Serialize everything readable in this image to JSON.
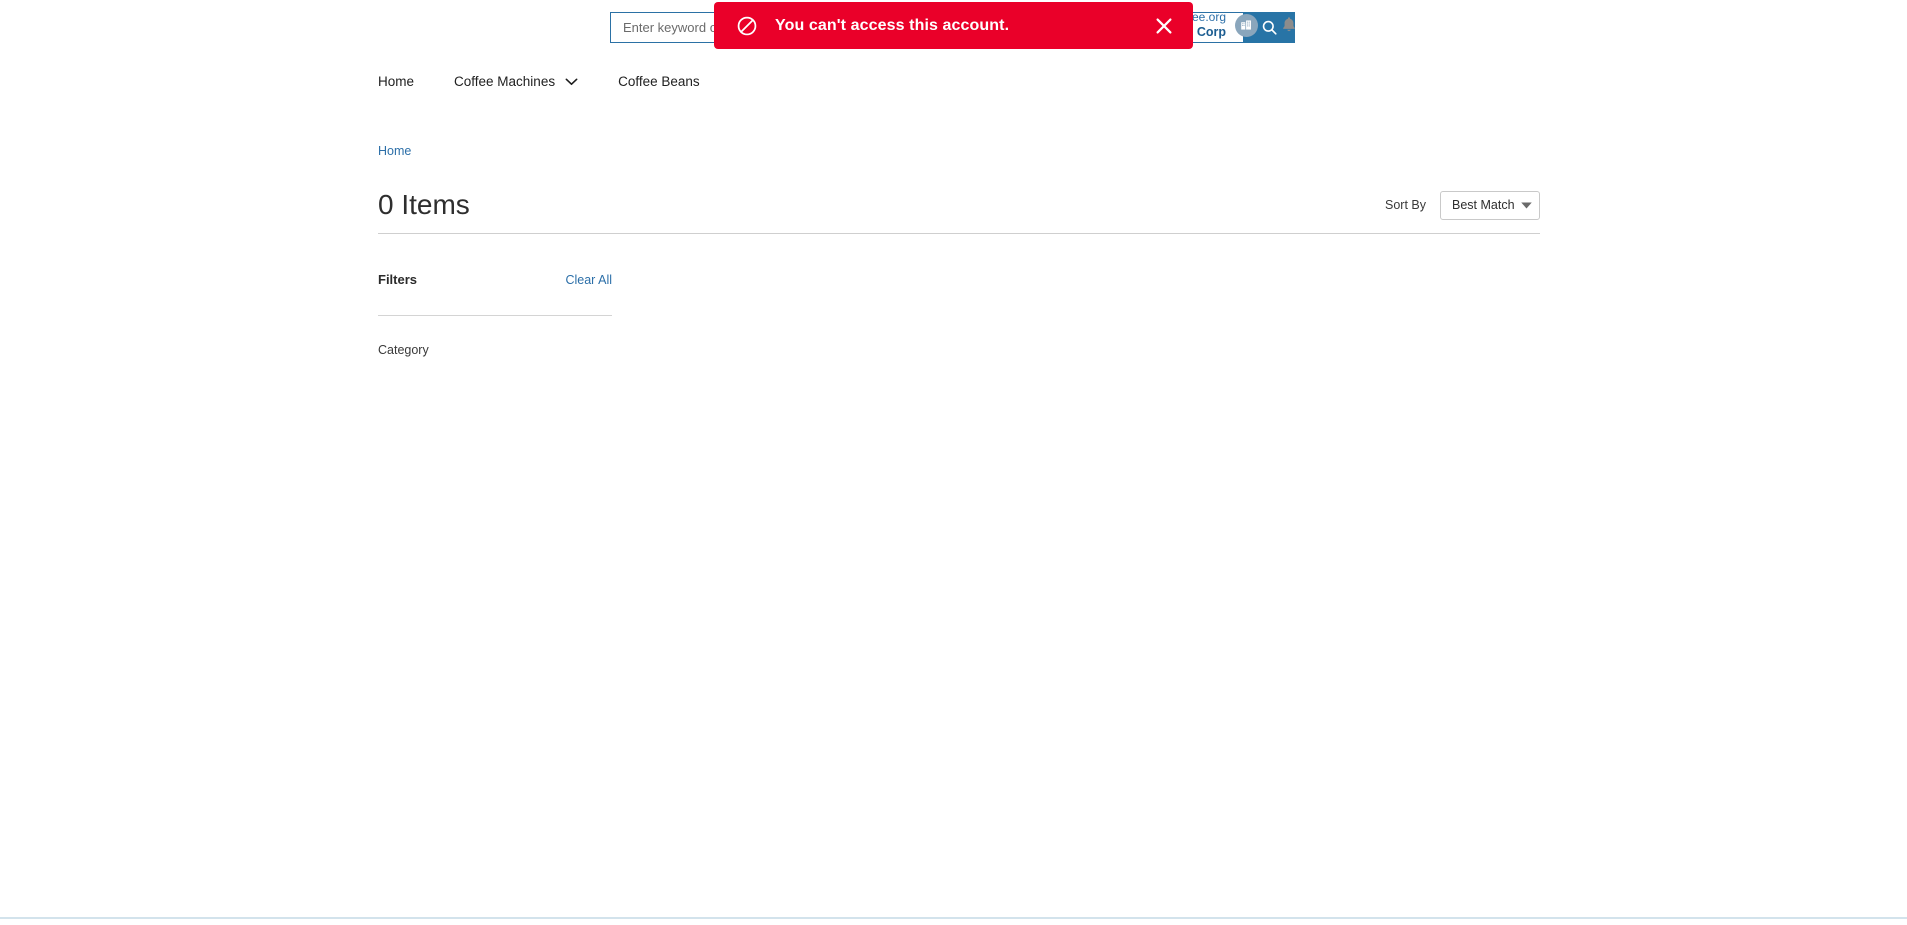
{
  "header": {
    "search": {
      "placeholder": "Enter keyword or SKU",
      "value": "",
      "button_icon": "search-icon"
    },
    "account": {
      "email": "lboyle@unitedcoffee.org",
      "company": "United Coffee Bean Corp",
      "avatar_icon": "building-icon",
      "notifications_icon": "bell-icon"
    }
  },
  "alert": {
    "message": "You can't access this account.",
    "icon": "block-icon",
    "close_icon": "close-icon",
    "background_color": "#ea0029",
    "text_color": "#ffffff"
  },
  "nav": {
    "items": [
      {
        "label": "Home",
        "has_caret": false
      },
      {
        "label": "Coffee Machines",
        "has_caret": true
      },
      {
        "label": "Coffee Beans",
        "has_caret": false
      }
    ]
  },
  "breadcrumb": {
    "items": [
      {
        "label": "Home"
      }
    ]
  },
  "results": {
    "title": "0 Items",
    "sort": {
      "label": "Sort By",
      "selected": "Best Match",
      "caret_icon": "chevron-down-icon"
    }
  },
  "filters": {
    "title": "Filters",
    "clear_all": "Clear All",
    "groups": [
      {
        "label": "Category"
      }
    ]
  },
  "colors": {
    "accent_blue": "#2874a6",
    "link_blue": "#2c6fa8",
    "alert_red": "#ea0029",
    "footer_rule": "#d3e3ec"
  }
}
